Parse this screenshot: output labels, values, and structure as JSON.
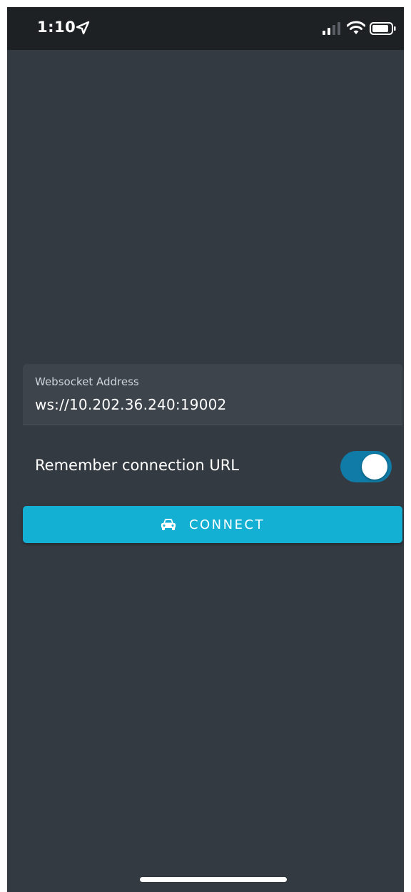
{
  "status_bar": {
    "time": "1:10",
    "icons": [
      "location-arrow-icon",
      "cellular-signal-icon",
      "wifi-icon",
      "battery-icon"
    ]
  },
  "connection_form": {
    "address_label": "Websocket Address",
    "address_value": "ws://10.202.36.240:19002",
    "remember_label": "Remember connection URL",
    "remember_enabled": true,
    "connect_label": "CONNECT",
    "connect_icon": "car-icon"
  },
  "colors": {
    "background": "#343a41",
    "status_bar": "#1e2124",
    "field_background": "#3d444c",
    "accent": "#13b0d4",
    "toggle_on": "#0f7ba6"
  }
}
